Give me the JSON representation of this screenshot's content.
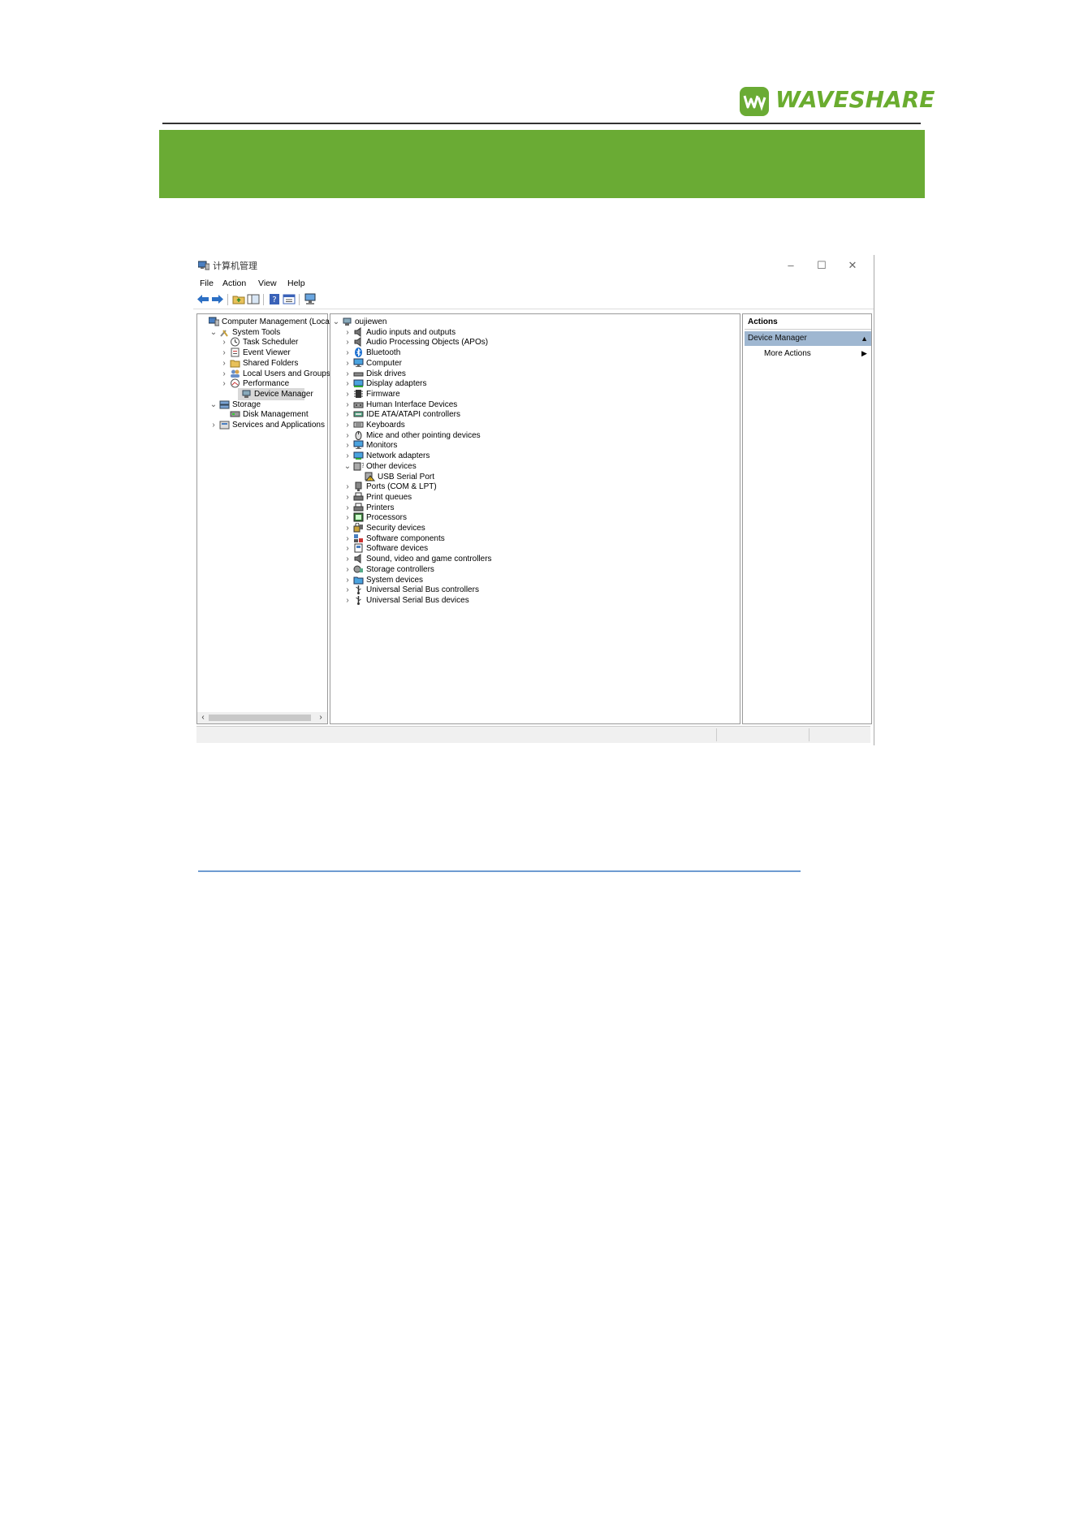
{
  "logo": {
    "text": "WAVESHARE"
  },
  "window": {
    "title": "计算机管理",
    "controls": {
      "minimize": "–",
      "maximize": "☐",
      "close": "✕"
    },
    "menu": [
      "File",
      "Action",
      "View",
      "Help"
    ]
  },
  "left_tree": {
    "items": [
      {
        "label": "Computer Management (Local",
        "icon": "computer-management-icon",
        "expander": ""
      },
      {
        "label": "System Tools",
        "icon": "tools-icon",
        "expander": "⌄"
      },
      {
        "label": "Task Scheduler",
        "icon": "clock-icon",
        "expander": "›"
      },
      {
        "label": "Event Viewer",
        "icon": "event-viewer-icon",
        "expander": "›"
      },
      {
        "label": "Shared Folders",
        "icon": "shared-folder-icon",
        "expander": "›"
      },
      {
        "label": "Local Users and Groups",
        "icon": "users-icon",
        "expander": "›"
      },
      {
        "label": "Performance",
        "icon": "performance-icon",
        "expander": "›"
      },
      {
        "label": "Device Manager",
        "icon": "device-manager-icon",
        "expander": ""
      },
      {
        "label": "Storage",
        "icon": "storage-icon",
        "expander": "⌄"
      },
      {
        "label": "Disk Management",
        "icon": "disk-management-icon",
        "expander": ""
      },
      {
        "label": "Services and Applications",
        "icon": "services-icon",
        "expander": "›"
      }
    ],
    "scroll_left": "‹",
    "scroll_right": "›"
  },
  "device_tree": {
    "root": "oujiewen",
    "items": [
      {
        "label": "Audio inputs and outputs",
        "icon": "speaker-icon",
        "expander": "›"
      },
      {
        "label": "Audio Processing Objects (APOs)",
        "icon": "speaker-icon",
        "expander": "›"
      },
      {
        "label": "Bluetooth",
        "icon": "bluetooth-icon",
        "expander": "›"
      },
      {
        "label": "Computer",
        "icon": "monitor-icon",
        "expander": "›"
      },
      {
        "label": "Disk drives",
        "icon": "disk-drive-icon",
        "expander": "›"
      },
      {
        "label": "Display adapters",
        "icon": "display-adapter-icon",
        "expander": "›"
      },
      {
        "label": "Firmware",
        "icon": "firmware-icon",
        "expander": "›"
      },
      {
        "label": "Human Interface Devices",
        "icon": "hid-icon",
        "expander": "›"
      },
      {
        "label": "IDE ATA/ATAPI controllers",
        "icon": "ide-controller-icon",
        "expander": "›"
      },
      {
        "label": "Keyboards",
        "icon": "keyboard-icon",
        "expander": "›"
      },
      {
        "label": "Mice and other pointing devices",
        "icon": "mouse-icon",
        "expander": "›"
      },
      {
        "label": "Monitors",
        "icon": "monitor-icon",
        "expander": "›"
      },
      {
        "label": "Network adapters",
        "icon": "network-adapter-icon",
        "expander": "›"
      },
      {
        "label": "Other devices",
        "icon": "unknown-device-icon",
        "expander": "⌄"
      },
      {
        "label": "USB Serial Port",
        "icon": "warning-device-icon",
        "expander": "",
        "child": true
      },
      {
        "label": "Ports (COM & LPT)",
        "icon": "port-icon",
        "expander": "›"
      },
      {
        "label": "Print queues",
        "icon": "printer-icon",
        "expander": "›"
      },
      {
        "label": "Printers",
        "icon": "printer-icon",
        "expander": "›"
      },
      {
        "label": "Processors",
        "icon": "processor-icon",
        "expander": "›"
      },
      {
        "label": "Security devices",
        "icon": "security-device-icon",
        "expander": "›"
      },
      {
        "label": "Software components",
        "icon": "software-component-icon",
        "expander": "›"
      },
      {
        "label": "Software devices",
        "icon": "software-device-icon",
        "expander": "›"
      },
      {
        "label": "Sound, video and game controllers",
        "icon": "speaker-icon",
        "expander": "›"
      },
      {
        "label": "Storage controllers",
        "icon": "storage-controller-icon",
        "expander": "›"
      },
      {
        "label": "System devices",
        "icon": "system-folder-icon",
        "expander": "›"
      },
      {
        "label": "Universal Serial Bus controllers",
        "icon": "usb-icon",
        "expander": "›"
      },
      {
        "label": "Universal Serial Bus devices",
        "icon": "usb-icon",
        "expander": "›"
      }
    ]
  },
  "actions": {
    "header": "Actions",
    "selected": "Device Manager",
    "more": "More Actions",
    "caret_up": "▲",
    "arrow_right": "▶"
  },
  "colors": {
    "brand_green": "#6aab34",
    "selection_blue": "#9fb7d1",
    "link_rule": "#6e9bd1"
  }
}
